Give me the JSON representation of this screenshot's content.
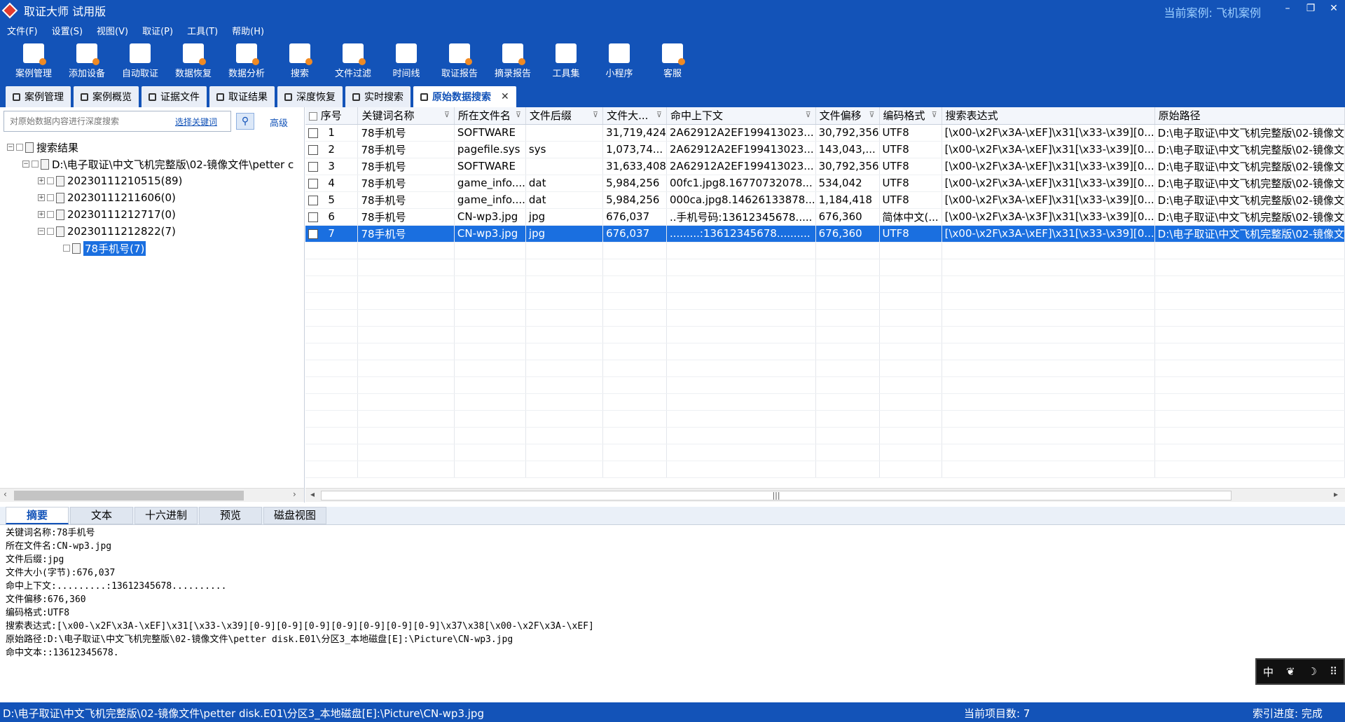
{
  "titlebar": {
    "title": "取证大师 试用版",
    "current_case": "当前案例: 飞机案例",
    "minimize": "–",
    "restore": "❐",
    "close": "✕"
  },
  "menu": [
    "文件(F)",
    "设置(S)",
    "视图(V)",
    "取证(P)",
    "工具(T)",
    "帮助(H)"
  ],
  "toolbar": [
    "案例管理",
    "添加设备",
    "自动取证",
    "数据恢复",
    "数据分析",
    "搜索",
    "文件过滤",
    "时间线",
    "取证报告",
    "摘录报告",
    "工具集",
    "小程序",
    "客服"
  ],
  "tabs": [
    "案例管理",
    "案例概览",
    "证据文件",
    "取证结果",
    "深度恢复",
    "实时搜索",
    "原始数据搜索"
  ],
  "search": {
    "placeholder": "对原始数据内容进行深度搜索",
    "select_keyword": "选择关键词",
    "advanced": "高级"
  },
  "tree": {
    "root": "搜索结果",
    "device": "D:\\电子取证\\中文飞机完整版\\02-镜像文件\\petter c",
    "nodes": [
      "20230111210515(89)",
      "20230111211606(0)",
      "20230111212717(0)",
      "20230111212822(7)"
    ],
    "leaf": "78手机号(7)"
  },
  "grid": {
    "columns": [
      "序号",
      "关键词名称",
      "所在文件名",
      "文件后缀",
      "文件大...",
      "命中上下文",
      "文件偏移",
      "编码格式",
      "搜索表达式",
      "原始路径"
    ],
    "rows": [
      [
        "1",
        "78手机号",
        "SOFTWARE",
        "",
        "31,719,424",
        "2A62912A2EF199413023...",
        "30,792,356",
        "UTF8",
        "[\\x00-\\x2F\\x3A-\\xEF]\\x31[\\x33-\\x39][0...",
        "D:\\电子取证\\中文飞机完整版\\02-镜像文"
      ],
      [
        "2",
        "78手机号",
        "pagefile.sys",
        "sys",
        "1,073,74...",
        "2A62912A2EF199413023...",
        "143,043,...",
        "UTF8",
        "[\\x00-\\x2F\\x3A-\\xEF]\\x31[\\x33-\\x39][0...",
        "D:\\电子取证\\中文飞机完整版\\02-镜像文"
      ],
      [
        "3",
        "78手机号",
        "SOFTWARE",
        "",
        "31,633,408",
        "2A62912A2EF199413023...",
        "30,792,356",
        "UTF8",
        "[\\x00-\\x2F\\x3A-\\xEF]\\x31[\\x33-\\x39][0...",
        "D:\\电子取证\\中文飞机完整版\\02-镜像文"
      ],
      [
        "4",
        "78手机号",
        "game_info....",
        "dat",
        "5,984,256",
        "00fc1.jpg8.16770732078...",
        "534,042",
        "UTF8",
        "[\\x00-\\x2F\\x3A-\\xEF]\\x31[\\x33-\\x39][0...",
        "D:\\电子取证\\中文飞机完整版\\02-镜像文"
      ],
      [
        "5",
        "78手机号",
        "game_info....",
        "dat",
        "5,984,256",
        "000ca.jpg8.14626133878...",
        "1,184,418",
        "UTF8",
        "[\\x00-\\x2F\\x3A-\\xEF]\\x31[\\x33-\\x39][0...",
        "D:\\电子取证\\中文飞机完整版\\02-镜像文"
      ],
      [
        "6",
        "78手机号",
        "CN-wp3.jpg",
        "jpg",
        "676,037",
        "..手机号码:13612345678.....",
        "676,360",
        "简体中文(...",
        "[\\x00-\\x2F\\x3A-\\x3F]\\x31[\\x33-\\x39][0...",
        "D:\\电子取证\\中文飞机完整版\\02-镜像文"
      ],
      [
        "7",
        "78手机号",
        "CN-wp3.jpg",
        "jpg",
        "676,037",
        ".........:13612345678..........",
        "676,360",
        "UTF8",
        "[\\x00-\\x2F\\x3A-\\xEF]\\x31[\\x33-\\x39][0...",
        "D:\\电子取证\\中文飞机完整版\\02-镜像文"
      ]
    ],
    "selected_row": 7
  },
  "bottom_tabs": [
    "摘要",
    "文本",
    "十六进制",
    "预览",
    "磁盘视图"
  ],
  "detail_lines": [
    "关键词名称:78手机号",
    "所在文件名:CN-wp3.jpg",
    "文件后缀:jpg",
    "文件大小(字节):676,037",
    "命中上下文:.........:13612345678..........",
    "文件偏移:676,360",
    "编码格式:UTF8",
    "搜索表达式:[\\x00-\\x2F\\x3A-\\xEF]\\x31[\\x33-\\x39][0-9][0-9][0-9][0-9][0-9][0-9][0-9]\\x37\\x38[\\x00-\\x2F\\x3A-\\xEF]",
    "原始路径:D:\\电子取证\\中文飞机完整版\\02-镜像文件\\petter disk.E01\\分区3_本地磁盘[E]:\\Picture\\CN-wp3.jpg",
    "命中文本::13612345678."
  ],
  "ime_widget": [
    "中",
    "❦",
    "☽",
    "⠿"
  ],
  "status": {
    "path": "D:\\电子取证\\中文飞机完整版\\02-镜像文件\\petter disk.E01\\分区3_本地磁盘[E]:\\Picture\\CN-wp3.jpg",
    "count": "当前项目数: 7",
    "index": "索引进度: 完成"
  },
  "colors": {
    "brand": "#1353b8",
    "selection": "#1a6fe0",
    "case_label": "#9ed0ff"
  }
}
